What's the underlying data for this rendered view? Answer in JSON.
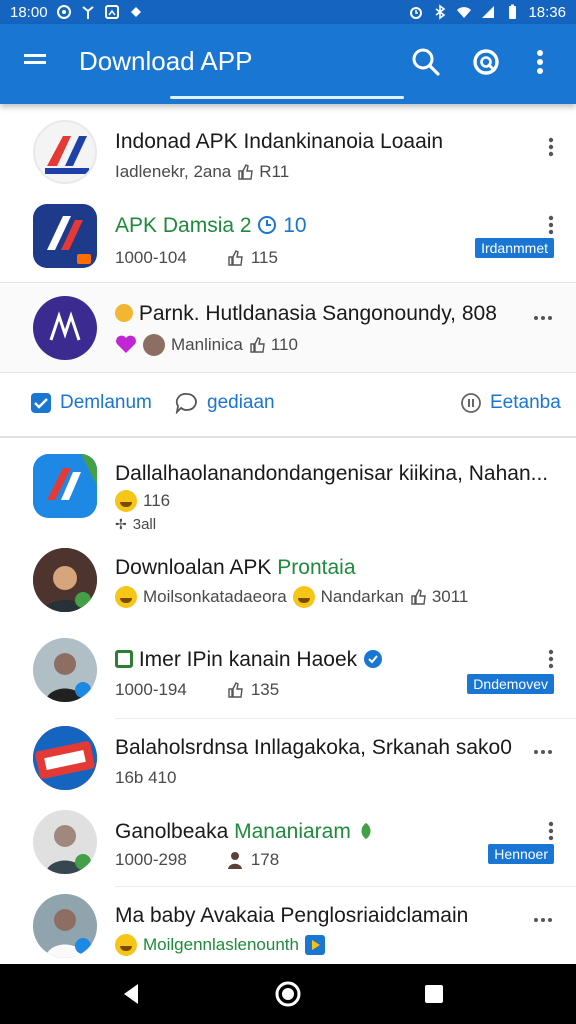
{
  "status_bar": {
    "time_left": "18:00",
    "time_right": "18:36"
  },
  "app_bar": {
    "title": "Download APP"
  },
  "rows": [
    {
      "title": "Indonad APK Indankinanoia Loaain",
      "sub1": "Iadlenekr, 2ana",
      "sub2": "R11"
    },
    {
      "title": "APK Damsia 2",
      "title_extra": "10",
      "sub1": "1000-104",
      "sub2": "115",
      "badge": "Irdanmmet"
    },
    {
      "title": "Parnk. Hutldanasia Sangonoundy, 808",
      "sub1": "Manlinica",
      "sub2": "110"
    },
    {
      "title": "Dallalhaolanandondangenisar kiikina, Nahan...",
      "sub1": "116",
      "sub2": "3all"
    },
    {
      "title": "Downloalan APK",
      "title_green": "Prontaia",
      "sub1": "Moilsonkatadaeora",
      "sub2": "Nandarkan",
      "sub3": "3011"
    },
    {
      "title": "Imer IPin kanain Haoek",
      "sub1": "1000-194",
      "sub2": "135",
      "badge": "Dndemovev"
    },
    {
      "title": "Balaholsrdnsa Inllagakoka, Srkanah sako0",
      "sub1": "16b 410"
    },
    {
      "title": "Ganolbeaka",
      "title_green": "Mananiaram",
      "sub1": "1000-298",
      "sub2": "178",
      "badge": "Hennoer"
    },
    {
      "title": "Ma baby Avakaia Penglosriaidclamain",
      "sub1": "Moilgennlaslenounth"
    }
  ],
  "actions": {
    "left": "Demlanum",
    "middle": "gediaan",
    "right": "Eetanba"
  },
  "colors": {
    "primary": "#1976d2",
    "status_bar": "#1565c0",
    "green_text": "#1f8a3a"
  }
}
